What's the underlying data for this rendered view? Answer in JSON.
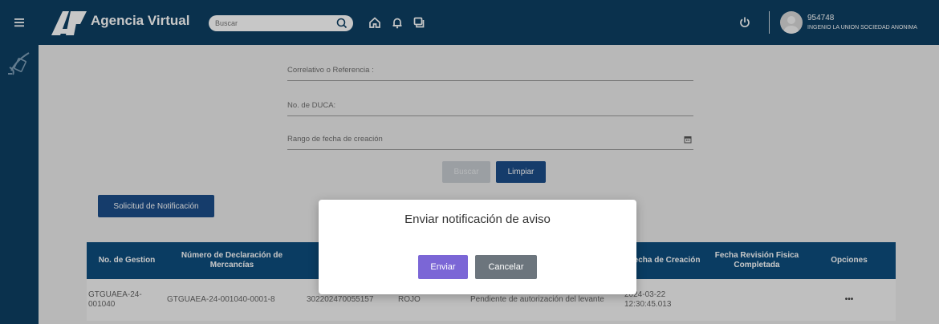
{
  "header": {
    "brand": "Agencia Virtual",
    "search_placeholder": "Buscar",
    "icons": [
      "menu-icon",
      "home-icon",
      "bell-icon",
      "chat-icon",
      "power-icon"
    ],
    "user": {
      "id": "954748",
      "company": "INGENIO LA UNION SOCIEDAD ANONIMA"
    }
  },
  "form": {
    "correlativo_label": "Correlativo o Referencia :",
    "duca_label": "No. de DUCA:",
    "rango_label": "Rango de fecha de creación",
    "buscar_label": "Buscar",
    "limpiar_label": "Limpiar",
    "solicitud_label": "Solicitud de Notificación"
  },
  "table": {
    "headers": [
      "No. de Gestion",
      "Número de Declaración de Mercancías",
      "",
      "",
      "",
      "Fecha de Creación",
      "Fecha Revisión Fisica Completada",
      "Opciones"
    ],
    "rows": [
      {
        "gestion": "GTGUAEA-24-001040",
        "declaracion": "GTGUAEA-24-001040-0001-8",
        "col3": "302202470055157",
        "col4": "ROJO",
        "col5": "Pendiente de autorización del levante",
        "fecha": "2024-03-22 12:30:45.013",
        "revision": "",
        "opciones": "•••"
      }
    ]
  },
  "modal": {
    "title": "Enviar notificación de aviso",
    "enviar_label": "Enviar",
    "cancelar_label": "Cancelar"
  },
  "colors": {
    "topbar": "#0d3f63",
    "primary_button": "#1c4e8a",
    "enviar_button": "#7b66d6",
    "cancelar_button": "#6c757d",
    "table_header": "#0e4d7e"
  }
}
